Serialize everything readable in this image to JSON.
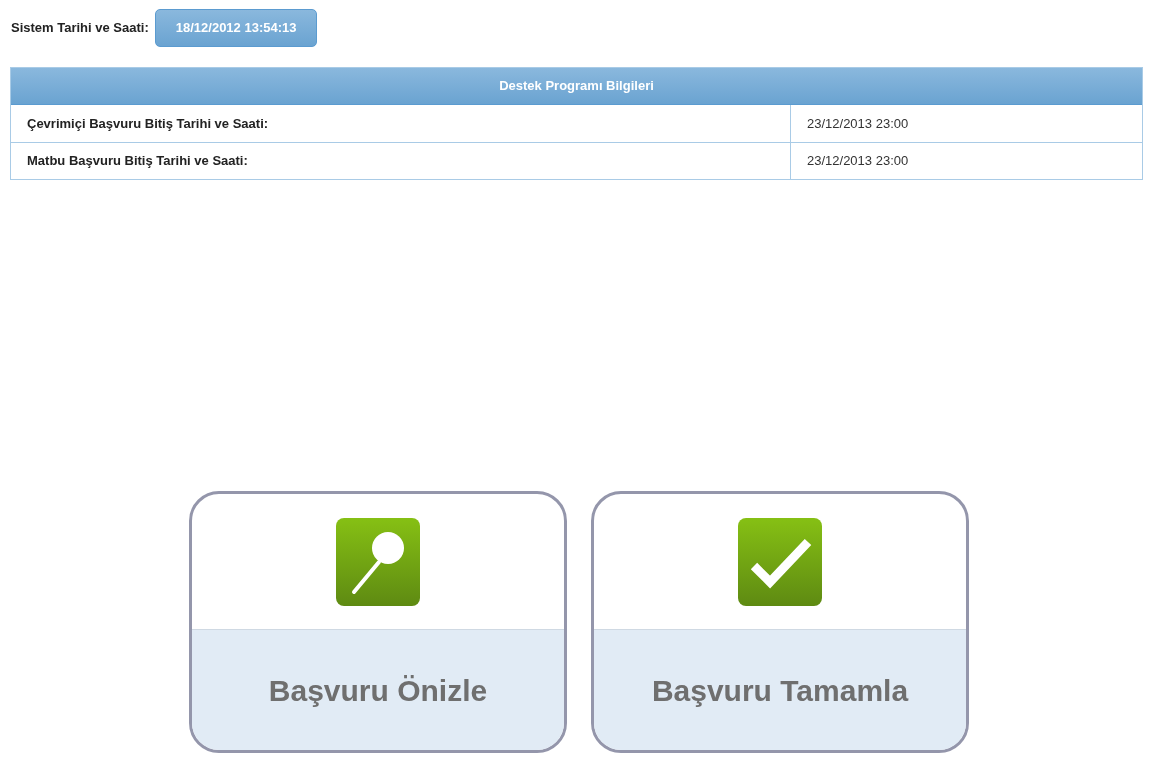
{
  "system_time": {
    "label": "Sistem Tarihi ve Saati:",
    "value": "18/12/2012 13:54:13"
  },
  "info_table": {
    "title": "Destek Programı Bilgileri",
    "rows": [
      {
        "label": "Çevrimiçi Başvuru Bitiş Tarihi ve Saati:",
        "value": "23/12/2013 23:00"
      },
      {
        "label": "Matbu Başvuru Bitiş Tarihi ve Saati:",
        "value": "23/12/2013 23:00"
      }
    ]
  },
  "actions": [
    {
      "kind": "preview",
      "label": "Başvuru Önizle"
    },
    {
      "kind": "complete",
      "label": "Başvuru Tamamla"
    }
  ]
}
